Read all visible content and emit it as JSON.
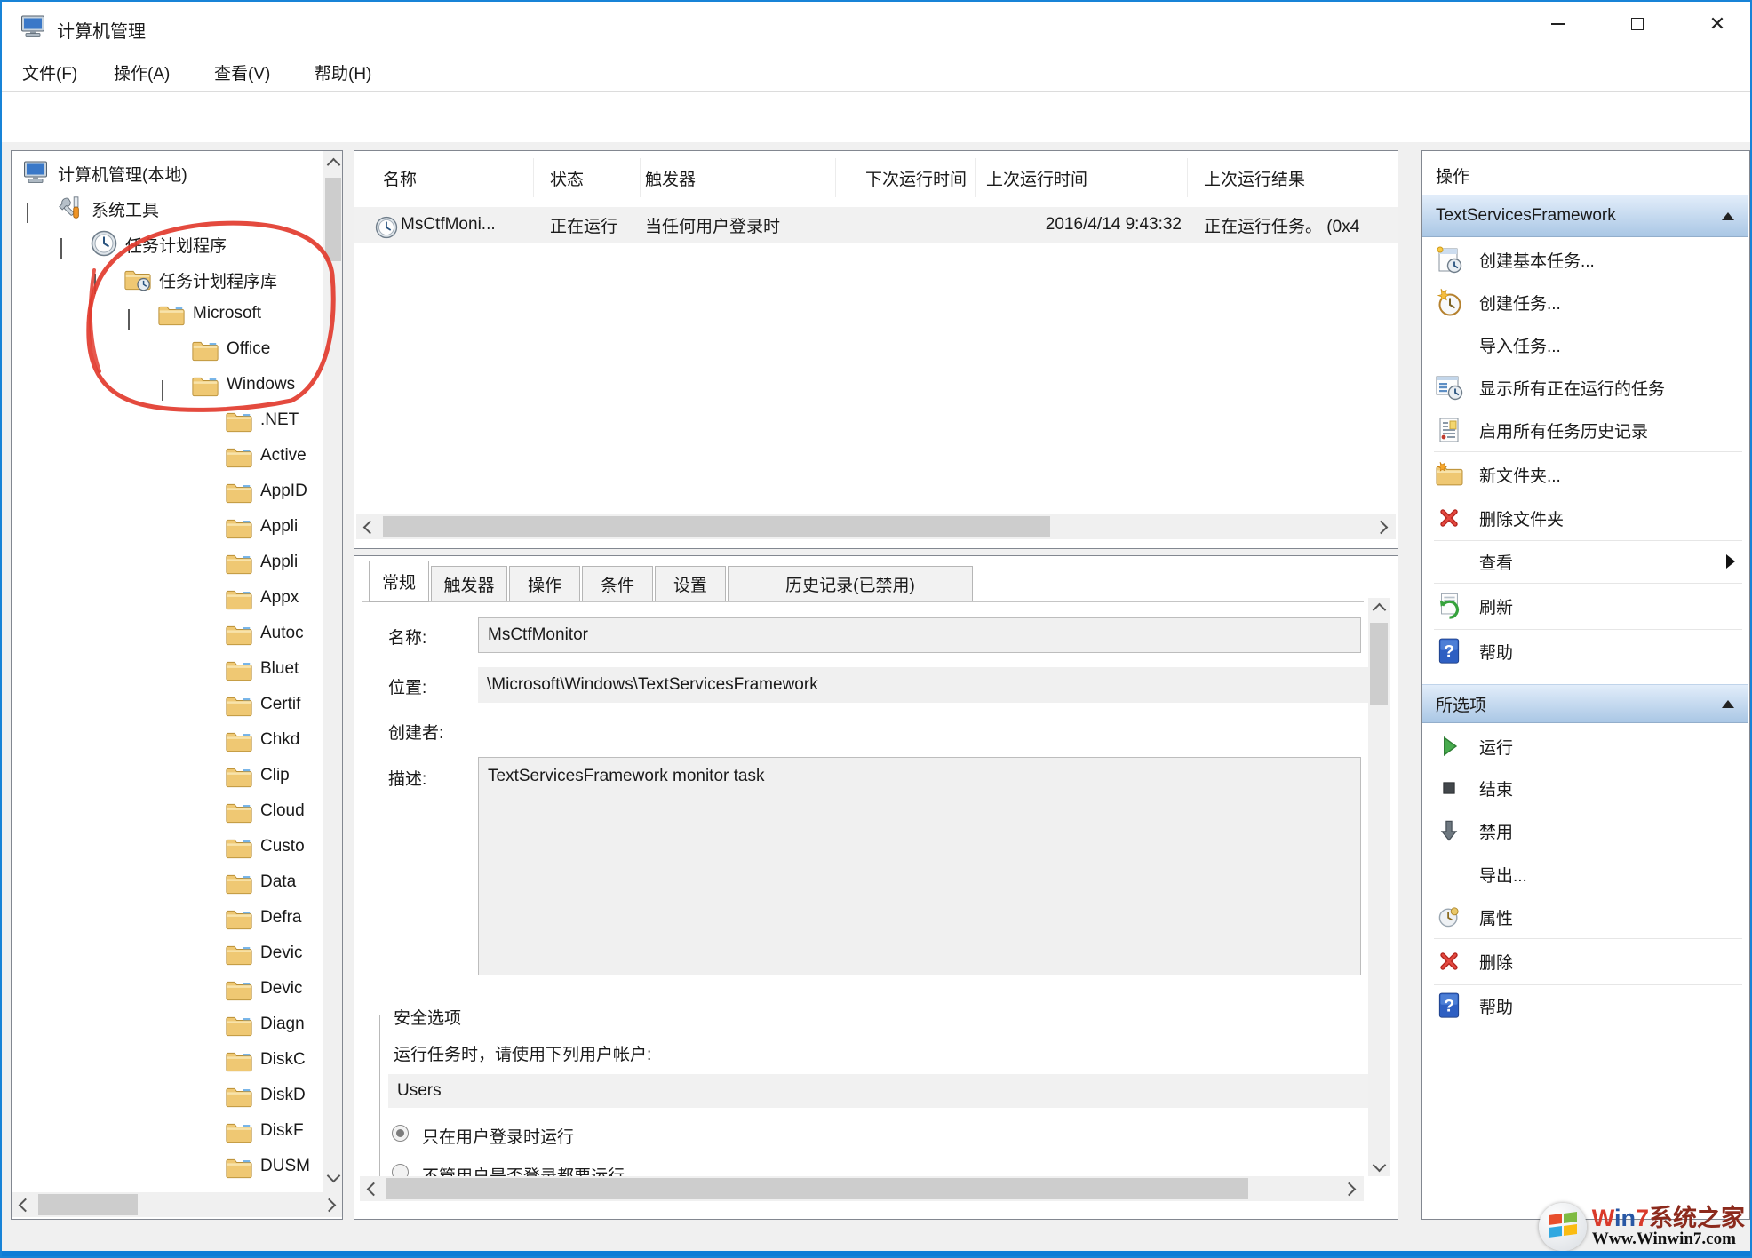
{
  "window": {
    "title": "计算机管理"
  },
  "menu": {
    "items": [
      "文件(F)",
      "操作(A)",
      "查看(V)",
      "帮助(H)"
    ]
  },
  "toolbar": {
    "icons": [
      "back",
      "forward",
      "up-folder",
      "console-tree-toggle",
      "help",
      "action-pane-toggle"
    ]
  },
  "tree": {
    "items": [
      {
        "label": "计算机管理(本地)",
        "icon": "computer",
        "level": 0,
        "expanded": null
      },
      {
        "label": "系统工具",
        "icon": "tools",
        "level": 1,
        "expanded": true
      },
      {
        "label": "任务计划程序",
        "icon": "clock",
        "level": 2,
        "expanded": true
      },
      {
        "label": "任务计划程序库",
        "icon": "folder-clock",
        "level": 3,
        "expanded": true
      },
      {
        "label": "Microsoft",
        "icon": "folder",
        "level": 4,
        "expanded": true
      },
      {
        "label": "Office",
        "icon": "folder",
        "level": 5,
        "expanded": null
      },
      {
        "label": "Windows",
        "icon": "folder",
        "level": 5,
        "expanded": true
      },
      {
        "label": ".NET",
        "icon": "folder",
        "level": 6,
        "expanded": null
      },
      {
        "label": "Active",
        "icon": "folder",
        "level": 6,
        "expanded": null
      },
      {
        "label": "AppID",
        "icon": "folder",
        "level": 6,
        "expanded": null
      },
      {
        "label": "Appli",
        "icon": "folder",
        "level": 6,
        "expanded": null
      },
      {
        "label": "Appli",
        "icon": "folder",
        "level": 6,
        "expanded": null
      },
      {
        "label": "Appx",
        "icon": "folder",
        "level": 6,
        "expanded": null
      },
      {
        "label": "Autoc",
        "icon": "folder",
        "level": 6,
        "expanded": null
      },
      {
        "label": "Bluet",
        "icon": "folder",
        "level": 6,
        "expanded": null
      },
      {
        "label": "Certif",
        "icon": "folder",
        "level": 6,
        "expanded": null
      },
      {
        "label": "Chkd",
        "icon": "folder",
        "level": 6,
        "expanded": null
      },
      {
        "label": "Clip",
        "icon": "folder",
        "level": 6,
        "expanded": null
      },
      {
        "label": "Cloud",
        "icon": "folder",
        "level": 6,
        "expanded": null
      },
      {
        "label": "Custo",
        "icon": "folder",
        "level": 6,
        "expanded": null
      },
      {
        "label": "Data",
        "icon": "folder",
        "level": 6,
        "expanded": null
      },
      {
        "label": "Defra",
        "icon": "folder",
        "level": 6,
        "expanded": null
      },
      {
        "label": "Devic",
        "icon": "folder",
        "level": 6,
        "expanded": null
      },
      {
        "label": "Devic",
        "icon": "folder",
        "level": 6,
        "expanded": null
      },
      {
        "label": "Diagn",
        "icon": "folder",
        "level": 6,
        "expanded": null
      },
      {
        "label": "DiskC",
        "icon": "folder",
        "level": 6,
        "expanded": null
      },
      {
        "label": "DiskD",
        "icon": "folder",
        "level": 6,
        "expanded": null
      },
      {
        "label": "DiskF",
        "icon": "folder",
        "level": 6,
        "expanded": null
      },
      {
        "label": "DUSM",
        "icon": "folder",
        "level": 6,
        "expanded": null
      }
    ]
  },
  "task_list": {
    "columns": [
      "名称",
      "状态",
      "触发器",
      "下次运行时间",
      "上次运行时间",
      "上次运行结果"
    ],
    "rows": [
      {
        "name": "MsCtfMoni...",
        "status": "正在运行",
        "trigger": "当任何用户登录时",
        "next_run": "",
        "last_run": "2016/4/14 9:43:32",
        "last_result": "正在运行任务。 (0x4"
      }
    ]
  },
  "details": {
    "tabs": [
      "常规",
      "触发器",
      "操作",
      "条件",
      "设置",
      "历史记录(已禁用)"
    ],
    "active_tab": "常规",
    "name_label": "名称:",
    "name_value": "MsCtfMonitor",
    "location_label": "位置:",
    "location_value": "\\Microsoft\\Windows\\TextServicesFramework",
    "creator_label": "创建者:",
    "description_label": "描述:",
    "description_value": "TextServicesFramework monitor task",
    "security": {
      "group_label": "安全选项",
      "account_hint": "运行任务时，请使用下列用户帐户:",
      "account": "Users",
      "option_logged_on": "只在用户登录时运行",
      "option_any": "不管用户是否登录都要运行"
    }
  },
  "actions": {
    "title": "操作",
    "sections": [
      {
        "header": "TextServicesFramework",
        "items": [
          {
            "label": "创建基本任务...",
            "icon": "basic-task"
          },
          {
            "label": "创建任务...",
            "icon": "create-task"
          },
          {
            "label": "导入任务...",
            "icon": ""
          },
          {
            "label": "显示所有正在运行的任务",
            "icon": "running-tasks"
          },
          {
            "label": "启用所有任务历史记录",
            "icon": "history"
          },
          {
            "label": "新文件夹...",
            "icon": "new-folder"
          },
          {
            "label": "删除文件夹",
            "icon": "delete-x"
          },
          {
            "label": "查看",
            "icon": "",
            "submenu": true
          },
          {
            "label": "刷新",
            "icon": "refresh"
          },
          {
            "label": "帮助",
            "icon": "help"
          }
        ]
      },
      {
        "header": "所选项",
        "items": [
          {
            "label": "运行",
            "icon": "run"
          },
          {
            "label": "结束",
            "icon": "end"
          },
          {
            "label": "禁用",
            "icon": "disable"
          },
          {
            "label": "导出...",
            "icon": ""
          },
          {
            "label": "属性",
            "icon": "properties"
          },
          {
            "label": "删除",
            "icon": "delete-x"
          },
          {
            "label": "帮助",
            "icon": "help"
          }
        ]
      }
    ]
  },
  "watermark": {
    "brand": [
      {
        "text": "W",
        "color": "#d93a2b"
      },
      {
        "text": "in",
        "color": "#2857a4"
      },
      {
        "text": "7",
        "color": "#d93a2b"
      },
      {
        "text": "系统之家",
        "color": "#8c2a1c"
      }
    ],
    "url": "Www.Winwin7.com"
  },
  "annotation": {
    "color": "#e23b2e",
    "shape": "hand-drawn-circle"
  }
}
